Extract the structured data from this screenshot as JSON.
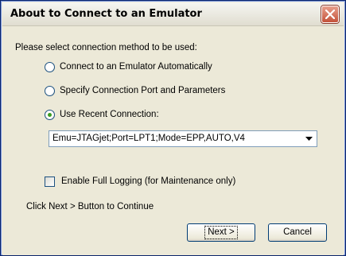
{
  "window": {
    "title": "About to Connect to an Emulator"
  },
  "dialog": {
    "prompt": "Please select connection method to be used:",
    "options": [
      {
        "label": "Connect to an Emulator Automatically",
        "selected": false
      },
      {
        "label": "Specify Connection Port and Parameters",
        "selected": false
      },
      {
        "label": "Use Recent Connection:",
        "selected": true
      }
    ],
    "recent_connection": {
      "value": "Emu=JTAGjet;Port=LPT1;Mode=EPP,AUTO,V4"
    },
    "logging_checkbox": {
      "label": "Enable Full Logging (for Maintenance only)",
      "checked": false
    },
    "hint": "Click Next > Button to Continue",
    "buttons": {
      "next": "Next >",
      "cancel": "Cancel"
    }
  },
  "icons": {
    "close": "close-icon",
    "dropdown": "chevron-down-icon"
  },
  "colors": {
    "dialog_bg": "#ece9d8",
    "close_button": "#c4523a",
    "radio_dot": "#3a9c22",
    "border_blue": "#1c5180"
  }
}
